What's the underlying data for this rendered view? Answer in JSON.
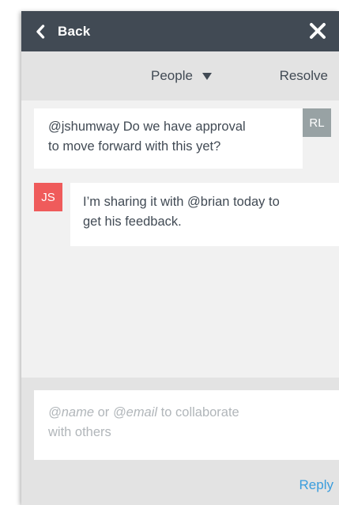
{
  "header": {
    "back_label": "Back",
    "back_icon": "chevron-left-icon",
    "close_icon": "close-icon",
    "background": "#414a54"
  },
  "toolbar": {
    "people_label": "People",
    "people_icon": "caret-down-icon",
    "resolve_label": "Resolve"
  },
  "messages": [
    {
      "author_initials": "RL",
      "avatar_color": "#98a2a4",
      "text_lines": [
        "@jshumway Do we have approval",
        "to move forward with this yet?"
      ]
    },
    {
      "author_initials": "JS",
      "avatar_color": "#ef5b5b",
      "text_lines": [
        "I’m sharing it with @brian today to",
        "get his feedback."
      ]
    }
  ],
  "composer": {
    "placeholder_name": "@name",
    "placeholder_or": "or",
    "placeholder_email": "@email",
    "placeholder_rest": "to collaborate",
    "placeholder_line2": "with others",
    "reply_label": "Reply",
    "reply_color": "#3a9ddd"
  }
}
